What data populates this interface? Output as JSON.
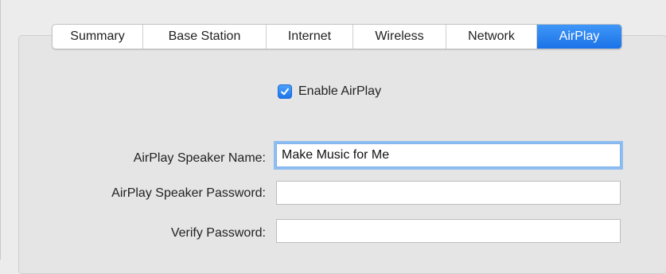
{
  "tabs": [
    {
      "label": "Summary",
      "active": false
    },
    {
      "label": "Base Station",
      "active": false
    },
    {
      "label": "Internet",
      "active": false
    },
    {
      "label": "Wireless",
      "active": false
    },
    {
      "label": "Network",
      "active": false
    },
    {
      "label": "AirPlay",
      "active": true
    }
  ],
  "enable_airplay": {
    "label": "Enable AirPlay",
    "checked": true
  },
  "fields": {
    "speaker_name": {
      "label": "AirPlay Speaker Name:",
      "value": "Make Music for Me"
    },
    "speaker_password": {
      "label": "AirPlay Speaker Password:",
      "value": ""
    },
    "verify_password": {
      "label": "Verify Password:",
      "value": ""
    }
  },
  "colors": {
    "accent": "#1b72e8",
    "panel": "#e5e5e5",
    "focus_ring": "#8ebdf2"
  }
}
